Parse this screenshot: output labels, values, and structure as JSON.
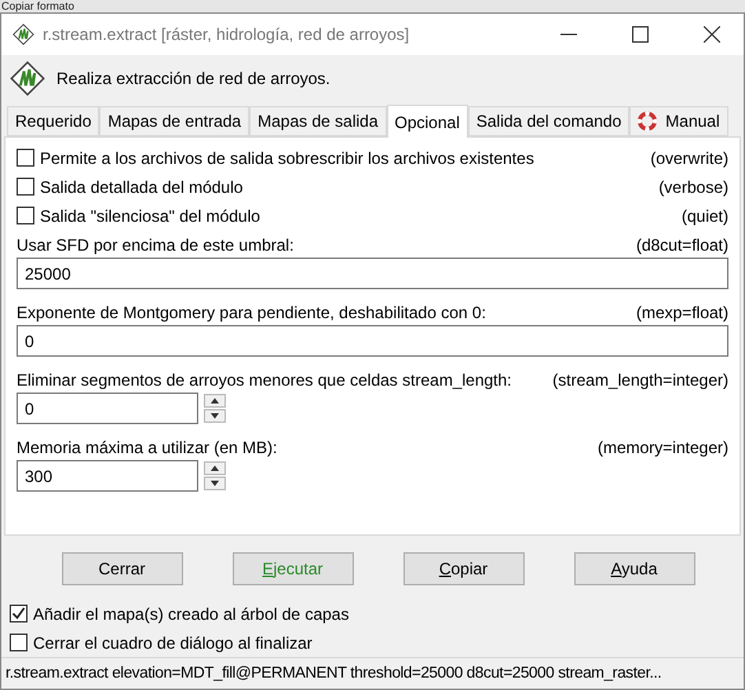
{
  "background_app": {
    "toolbar_text": "Copiar formato"
  },
  "window": {
    "title": "r.stream.extract [ráster, hidrología, red de arroyos]"
  },
  "header": {
    "description": "Realiza extracción de red de arroyos."
  },
  "tabs": [
    {
      "label": "Requerido",
      "selected": false,
      "kind": "text"
    },
    {
      "label": "Mapas de entrada",
      "selected": false,
      "kind": "text"
    },
    {
      "label": "Mapas de salida",
      "selected": false,
      "kind": "text"
    },
    {
      "label": "Opcional",
      "selected": true,
      "kind": "text"
    },
    {
      "label": "Salida del comando",
      "selected": false,
      "kind": "text"
    },
    {
      "label": "Manual",
      "selected": false,
      "kind": "help"
    }
  ],
  "options": [
    {
      "kind": "checkbox",
      "label": "Permite a los archivos de salida sobrescribir los archivos existentes",
      "flag": "(overwrite)",
      "checked": false
    },
    {
      "kind": "checkbox",
      "label": "Salida detallada del módulo",
      "flag": "(verbose)",
      "checked": false
    },
    {
      "kind": "checkbox",
      "label": "Salida \"silenciosa\" del módulo",
      "flag": "(quiet)",
      "checked": false
    },
    {
      "kind": "text",
      "label": "Usar SFD por encima de este umbral:",
      "flag": "(d8cut=float)",
      "value": "25000"
    },
    {
      "kind": "text",
      "label": "Exponente de Montgomery para pendiente, deshabilitado con 0:",
      "flag": "(mexp=float)",
      "value": "0"
    },
    {
      "kind": "spin",
      "label": "Eliminar segmentos de arroyos menores que celdas stream_length:",
      "flag": "(stream_length=integer)",
      "value": "0"
    },
    {
      "kind": "spin",
      "label": "Memoria máxima a utilizar (en MB):",
      "flag": "(memory=integer)",
      "value": "300"
    }
  ],
  "buttons": [
    {
      "label": "Cerrar",
      "kind": "plain"
    },
    {
      "label": "Ejecutar",
      "kind": "primary"
    },
    {
      "label": "Copiar",
      "kind": "plain"
    },
    {
      "label": "Ayuda",
      "kind": "plain"
    }
  ],
  "footer_options": [
    {
      "label": "Añadir el mapa(s) creado al árbol de capas",
      "checked": true
    },
    {
      "label": "Cerrar el cuadro de diálogo al finalizar",
      "checked": false
    }
  ],
  "status_bar": {
    "command": "r.stream.extract elevation=MDT_fill@PERMANENT threshold=25000 d8cut=25000 stream_raster..."
  }
}
